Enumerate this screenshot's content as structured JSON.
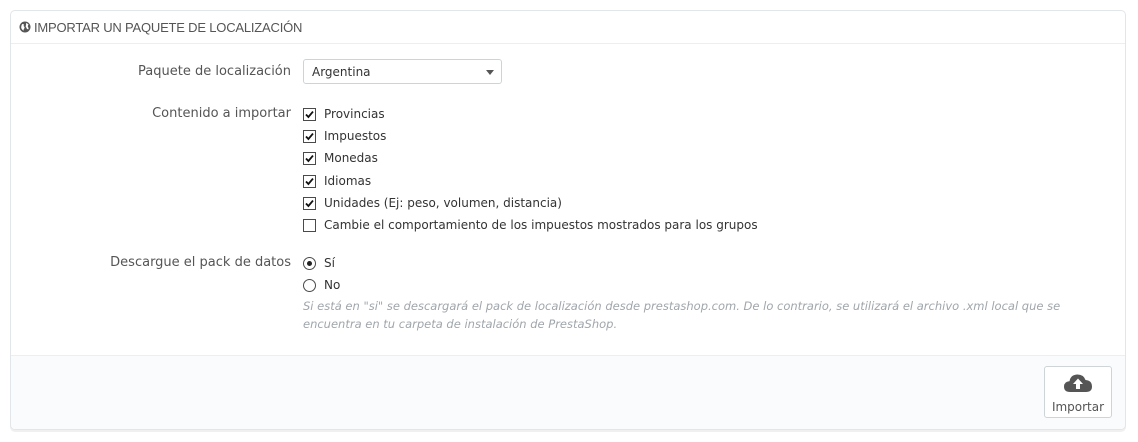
{
  "panel": {
    "title": "IMPORTAR UN PAQUETE DE LOCALIZACIÓN",
    "title_icon": "globe-icon"
  },
  "form": {
    "package_label": "Paquete de localización",
    "package_selected": "Argentina",
    "content_label": "Contenido a importar",
    "content_items": [
      {
        "label": "Provincias",
        "checked": true
      },
      {
        "label": "Impuestos",
        "checked": true
      },
      {
        "label": "Monedas",
        "checked": true
      },
      {
        "label": "Idiomas",
        "checked": true
      },
      {
        "label": "Unidades (Ej: peso, volumen, distancia)",
        "checked": true
      },
      {
        "label": "Cambie el comportamiento de los impuestos mostrados para los grupos",
        "checked": false
      }
    ],
    "download_label": "Descargue el pack de datos",
    "download_options": [
      {
        "label": "Sí",
        "selected": true
      },
      {
        "label": "No",
        "selected": false
      }
    ],
    "help_text": "Si está en \"si\" se descargará el pack de localización desde prestashop.com. De lo contrario, se utilizará el archivo .xml local que se encuentra en tu carpeta de instalación de PrestaShop."
  },
  "footer": {
    "import_label": "Importar",
    "import_icon": "cloud-upload-icon"
  }
}
